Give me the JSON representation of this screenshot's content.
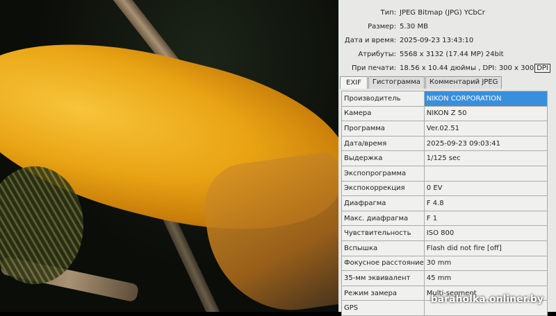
{
  "info": [
    {
      "label": "Тип:",
      "value": "JPEG Bitmap (JPG) YCbCr"
    },
    {
      "label": "Размер:",
      "value": "5.30 MB"
    },
    {
      "label": "Дата и время:",
      "value": "2025-09-23 13:43:10"
    },
    {
      "label": "Атрибуты:",
      "value": "5568 x 3132 (17.44 MP)  24bit"
    },
    {
      "label": "При печати:",
      "value": "18.56 x 10.44 дюймы ,  DPI: 300 x 300"
    }
  ],
  "dpi_button": "DPI",
  "tabs": [
    "EXIF",
    "Гистограмма",
    "Комментарий JPEG"
  ],
  "exif": [
    {
      "k": "Производитель",
      "v": "NIKON CORPORATION"
    },
    {
      "k": "Камера",
      "v": "NIKON Z 50"
    },
    {
      "k": "Программа",
      "v": "Ver.02.51"
    },
    {
      "k": "Дата/время",
      "v": "2025-09-23 09:03:41"
    },
    {
      "k": "Выдержка",
      "v": "1/125 sec"
    },
    {
      "k": "Экспопрограмма",
      "v": ""
    },
    {
      "k": "Экспокоррекция",
      "v": "0 EV"
    },
    {
      "k": "Диафрагма",
      "v": "F 4.8"
    },
    {
      "k": "Макс. диафрагма",
      "v": "F 1"
    },
    {
      "k": "Чувствительность",
      "v": "ISO 800"
    },
    {
      "k": "Вспышка",
      "v": "Flash did not fire [off]"
    },
    {
      "k": "Фокусное расстояние",
      "v": "30 mm"
    },
    {
      "k": "35-мм эквивалент",
      "v": "45 mm"
    },
    {
      "k": "Режим замера",
      "v": "Multi-segment"
    },
    {
      "k": "GPS",
      "v": ""
    }
  ],
  "watermark": "baraholka.onliner.by"
}
